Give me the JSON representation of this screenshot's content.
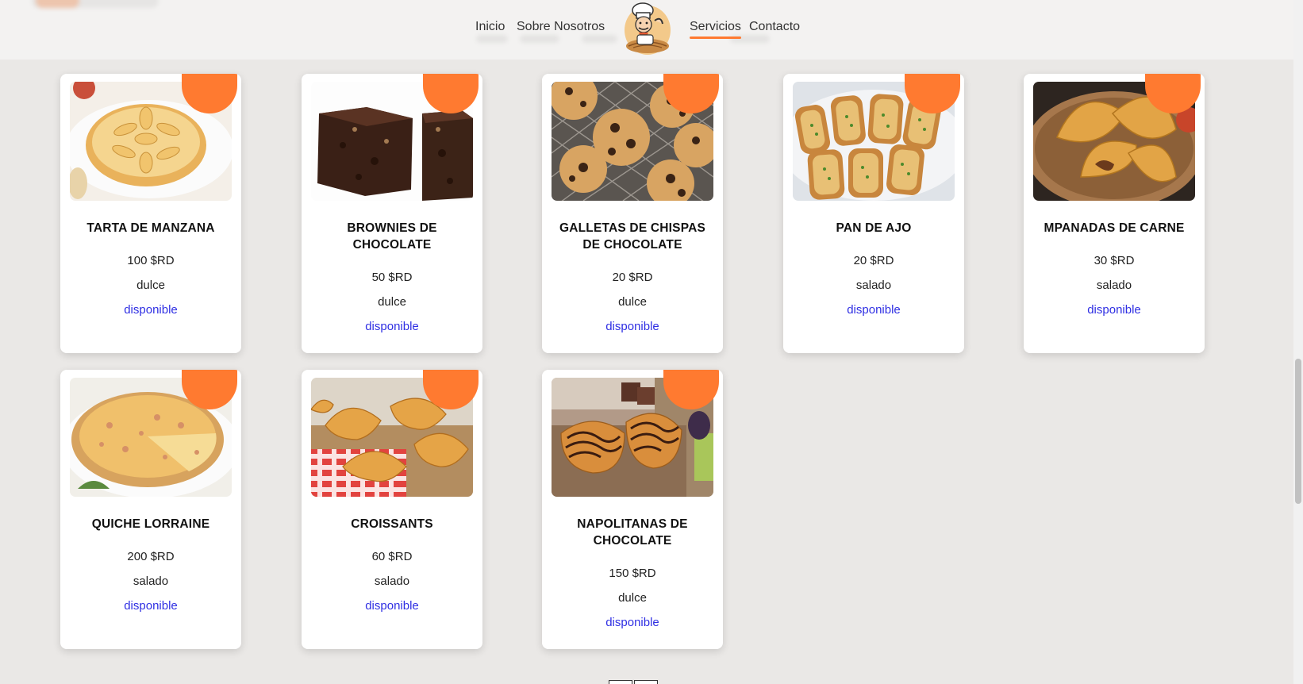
{
  "nav": {
    "items": [
      {
        "label": "Inicio"
      },
      {
        "label": "Sobre Nosotros"
      },
      {
        "label": "Servicios",
        "active": true
      },
      {
        "label": "Contacto"
      }
    ]
  },
  "accent_color": "#ff7a30",
  "link_color": "#2f2fe3",
  "products": [
    {
      "name": "TARTA DE MANZANA",
      "price": "100 $RD",
      "category": "dulce",
      "status": "disponible",
      "image": "apple-tart"
    },
    {
      "name": "BROWNIES DE CHOCOLATE",
      "price": "50 $RD",
      "category": "dulce",
      "status": "disponible",
      "image": "brownies"
    },
    {
      "name": "GALLETAS DE CHISPAS DE CHOCOLATE",
      "price": "20 $RD",
      "category": "dulce",
      "status": "disponible",
      "image": "chocolate-chip-cookies"
    },
    {
      "name": "PAN DE AJO",
      "price": "20 $RD",
      "category": "salado",
      "status": "disponible",
      "image": "garlic-bread"
    },
    {
      "name": "MPANADAS DE CARNE",
      "price": "30 $RD",
      "category": "salado",
      "status": "disponible",
      "image": "empanadas"
    },
    {
      "name": "QUICHE LORRAINE",
      "price": "200 $RD",
      "category": "salado",
      "status": "disponible",
      "image": "quiche"
    },
    {
      "name": "CROISSANTS",
      "price": "60 $RD",
      "category": "salado",
      "status": "disponible",
      "image": "croissants"
    },
    {
      "name": "NAPOLITANAS DE CHOCOLATE",
      "price": "150 $RD",
      "category": "dulce",
      "status": "disponible",
      "image": "chocolate-napolitanas"
    }
  ]
}
